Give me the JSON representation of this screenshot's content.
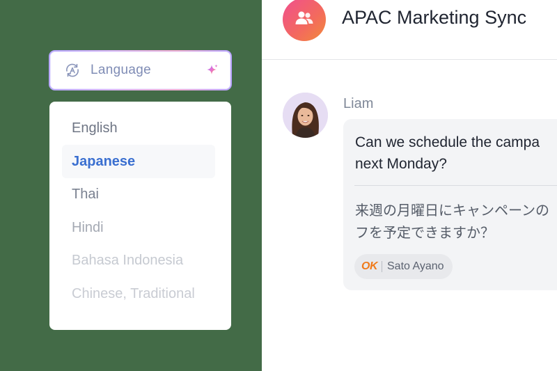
{
  "language_picker": {
    "label": "Language",
    "icon": "translate-icon",
    "ai_icon": "sparkle-icon",
    "options": [
      {
        "label": "English",
        "color": "#6e7584"
      },
      {
        "label": "Japanese",
        "color": "#3a6fd0",
        "selected": true
      },
      {
        "label": "Thai",
        "color": "#7a8190"
      },
      {
        "label": "Hindi",
        "color": "#a4a9b3"
      },
      {
        "label": "Bahasa Indonesia",
        "color": "#c6cad1"
      },
      {
        "label": "Chinese, Traditional",
        "color": "#c9ccd3"
      }
    ]
  },
  "chat": {
    "title": "APAC Marketing Sync",
    "group_icon": "group-users-icon",
    "message": {
      "sender": "Liam",
      "text": "Can we schedule the campa\nnext Monday?",
      "translation": "来週の月曜日にキャンペーンの\nフを予定できますか？",
      "translator_logo": "OK",
      "translator_name": "Sato Ayano"
    }
  },
  "colors": {
    "panel_bg": "#436b47",
    "accent": "#3a6fd0",
    "group_avatar": "#f36a5d",
    "logo_orange": "#f07a1a"
  }
}
